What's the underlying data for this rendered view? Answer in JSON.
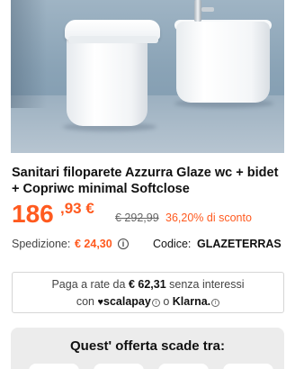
{
  "product": {
    "image_alt": "",
    "title": "Sanitari filoparete Azzurra Glaze wc + bidet + Copriwc minimal Softclose"
  },
  "price": {
    "integer": "186",
    "decimal": ",93 €",
    "old": "€ 292,99",
    "discount": "36,20% di sconto",
    "accent_color": "#ff5a1f"
  },
  "shipping": {
    "label": "Spedizione:",
    "value": "€ 24,30",
    "info_icon": "i"
  },
  "code": {
    "label": "Codice:",
    "value": "GLAZETERRAS"
  },
  "installments": {
    "prefix": "Paga a rate da",
    "amount": "€ 62,31",
    "suffix": "senza interessi",
    "with": "con",
    "scalapay": "scalapay",
    "or": "o",
    "klarna": "Klarna.",
    "info_icon": "i"
  },
  "offer": {
    "title": "Quest' offerta scade tra:"
  }
}
